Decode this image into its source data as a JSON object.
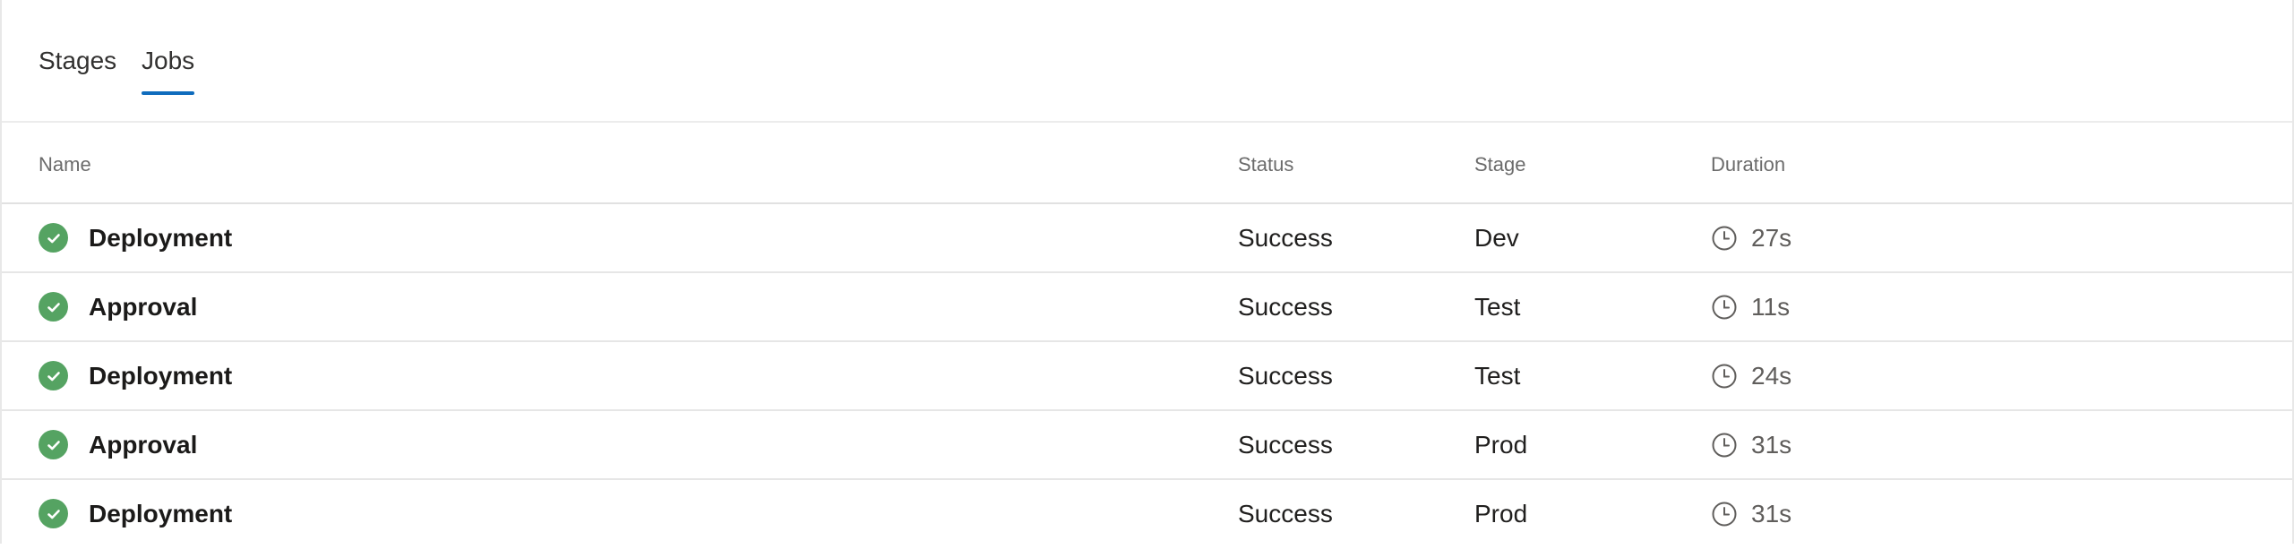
{
  "tabs": [
    {
      "label": "Stages",
      "active": false
    },
    {
      "label": "Jobs",
      "active": true
    }
  ],
  "columns": {
    "name": "Name",
    "status": "Status",
    "stage": "Stage",
    "duration": "Duration"
  },
  "rows": [
    {
      "name": "Deployment",
      "status": "Success",
      "stage": "Dev",
      "duration": "27s",
      "status_icon": "success-check-icon"
    },
    {
      "name": "Approval",
      "status": "Success",
      "stage": "Test",
      "duration": "11s",
      "status_icon": "success-check-icon"
    },
    {
      "name": "Deployment",
      "status": "Success",
      "stage": "Test",
      "duration": "24s",
      "status_icon": "success-check-icon"
    },
    {
      "name": "Approval",
      "status": "Success",
      "stage": "Prod",
      "duration": "31s",
      "status_icon": "success-check-icon"
    },
    {
      "name": "Deployment",
      "status": "Success",
      "stage": "Prod",
      "duration": "31s",
      "status_icon": "success-check-icon"
    }
  ],
  "colors": {
    "accent": "#0f6cbd",
    "success": "#55a362",
    "header_text": "#6b6b6b",
    "border": "#e6e6e6"
  }
}
